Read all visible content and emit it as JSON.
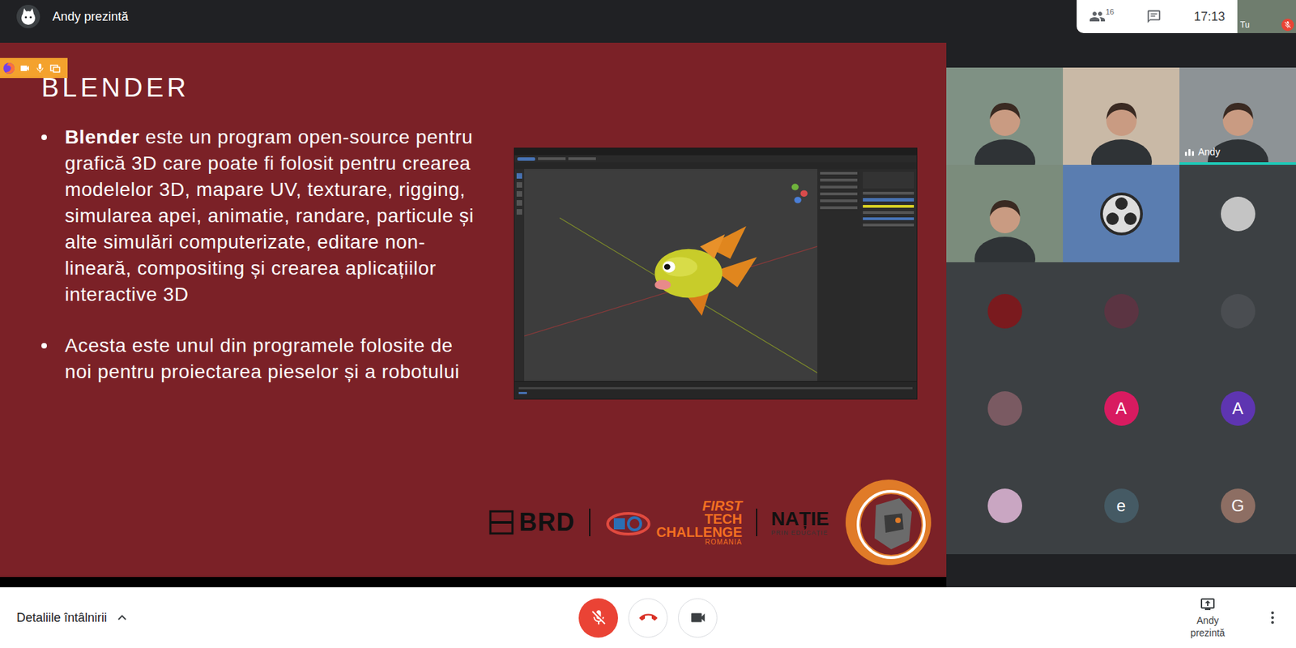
{
  "top_bar": {
    "presenter": "Andy prezintă",
    "participants_count": "16",
    "time": "17:13",
    "self_view": {
      "label": "Tu",
      "mic_muted": true
    }
  },
  "slide": {
    "title": "BLENDER",
    "bullets": [
      {
        "bold": "Blender",
        "text": " este un program open-source pentru grafică 3D care poate fi folosit pentru crearea modelelor 3D, mapare UV, texturare, rigging, simularea apei, animatie, randare, particule și alte simulări computerizate, editare non-lineară, compositing și crearea aplicațiilor interactive 3D"
      },
      {
        "text": "Acesta este unul din programele folosite de noi pentru proiectarea pieselor și a robotului"
      }
    ],
    "logos": {
      "brd": "BRD",
      "ftc": [
        "FIRST",
        "TECH",
        "CHALLENGE"
      ],
      "ftc_country": "ROMANIA",
      "natie": "NAȚIE",
      "natie_sub": "PRIN EDUCAȚIE"
    }
  },
  "participants": [
    {
      "kind": "video",
      "speaking": false,
      "color": "#7f9184"
    },
    {
      "kind": "video",
      "speaking": false,
      "color": "#c9b9a6"
    },
    {
      "kind": "video",
      "name": "Andy",
      "speaking": true,
      "color": "#8d9396"
    },
    {
      "kind": "video",
      "speaking": false,
      "color": "#7b8c7c"
    },
    {
      "kind": "obs",
      "speaking": false,
      "color": "#5a7db0"
    },
    {
      "kind": "avatar",
      "speaking": false,
      "color": "#c4c4c4"
    },
    {
      "kind": "avatar",
      "speaking": false,
      "color": "#7a1a1e"
    },
    {
      "kind": "avatar",
      "speaking": false,
      "color": "#5b3442"
    },
    {
      "kind": "avatar",
      "speaking": false,
      "color": "#4a4d51"
    },
    {
      "kind": "avatar",
      "speaking": false,
      "color": "#7a5a62"
    },
    {
      "kind": "letter",
      "letter": "A",
      "speaking": false,
      "color": "#d81b60"
    },
    {
      "kind": "letter",
      "letter": "A",
      "speaking": false,
      "color": "#5e35b1"
    },
    {
      "kind": "avatar",
      "speaking": false,
      "color": "#c9a6c2"
    },
    {
      "kind": "letter",
      "letter": "e",
      "speaking": false,
      "color": "#455a64"
    },
    {
      "kind": "letter",
      "letter": "G",
      "speaking": false,
      "color": "#8d6e63"
    }
  ],
  "bottom_bar": {
    "details": "Detaliile întâlnirii",
    "details_expanded": false,
    "mic_muted": true,
    "camera_off": false,
    "presenting": "Andy prezintă"
  }
}
